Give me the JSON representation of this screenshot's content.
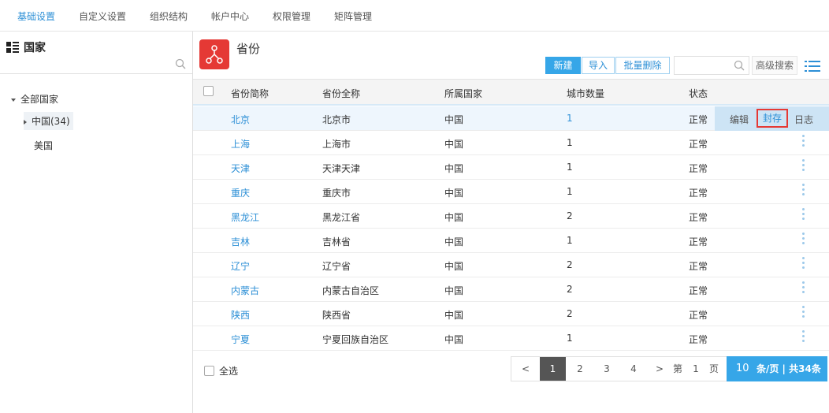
{
  "topnav": {
    "tabs": [
      "基础设置",
      "自定义设置",
      "组织结构",
      "帐户中心",
      "权限管理",
      "矩阵管理"
    ]
  },
  "sidebar": {
    "title": "国家",
    "search_placeholder": "",
    "tree": {
      "root": "全部国家",
      "children": [
        {
          "label": "中国(34)",
          "expanded": false,
          "selected": true
        },
        {
          "label": "美国"
        }
      ]
    }
  },
  "page": {
    "title": "省份",
    "icon": "org-structure-icon",
    "icon_color": "#e53935"
  },
  "toolbar": {
    "new_label": "新建",
    "import_label": "导入",
    "batch_delete_label": "批量删除",
    "search_placeholder": "",
    "advanced_search_label": "高级搜索"
  },
  "table": {
    "columns": [
      "省份简称",
      "省份全称",
      "所属国家",
      "城市数量",
      "状态"
    ],
    "rows": [
      {
        "short": "北京",
        "full": "北京市",
        "country": "中国",
        "cities": "1",
        "status": "正常"
      },
      {
        "short": "上海",
        "full": "上海市",
        "country": "中国",
        "cities": "1",
        "status": "正常"
      },
      {
        "short": "天津",
        "full": "天津天津",
        "country": "中国",
        "cities": "1",
        "status": "正常"
      },
      {
        "short": "重庆",
        "full": "重庆市",
        "country": "中国",
        "cities": "1",
        "status": "正常"
      },
      {
        "short": "黑龙江",
        "full": "黑龙江省",
        "country": "中国",
        "cities": "2",
        "status": "正常"
      },
      {
        "short": "吉林",
        "full": "吉林省",
        "country": "中国",
        "cities": "1",
        "status": "正常"
      },
      {
        "short": "辽宁",
        "full": "辽宁省",
        "country": "中国",
        "cities": "2",
        "status": "正常"
      },
      {
        "short": "内蒙古",
        "full": "内蒙古自治区",
        "country": "中国",
        "cities": "2",
        "status": "正常"
      },
      {
        "short": "陕西",
        "full": "陕西省",
        "country": "中国",
        "cities": "2",
        "status": "正常"
      },
      {
        "short": "宁夏",
        "full": "宁夏回族自治区",
        "country": "中国",
        "cities": "1",
        "status": "正常"
      }
    ],
    "row_actions": {
      "edit": "编辑",
      "seal": "封存",
      "log": "日志"
    }
  },
  "footer": {
    "select_all_label": "全选",
    "pager": {
      "prev": "<",
      "pages": [
        "1",
        "2",
        "3",
        "4"
      ],
      "current": "1",
      "next": ">",
      "goto_prefix": "第",
      "goto_value": "1",
      "goto_suffix": "页",
      "page_size": "10",
      "summary": "条/页 | 共34条"
    }
  },
  "colors": {
    "accent": "#36a6e8",
    "link": "#2c8fd6",
    "highlight_border": "#e53935"
  }
}
